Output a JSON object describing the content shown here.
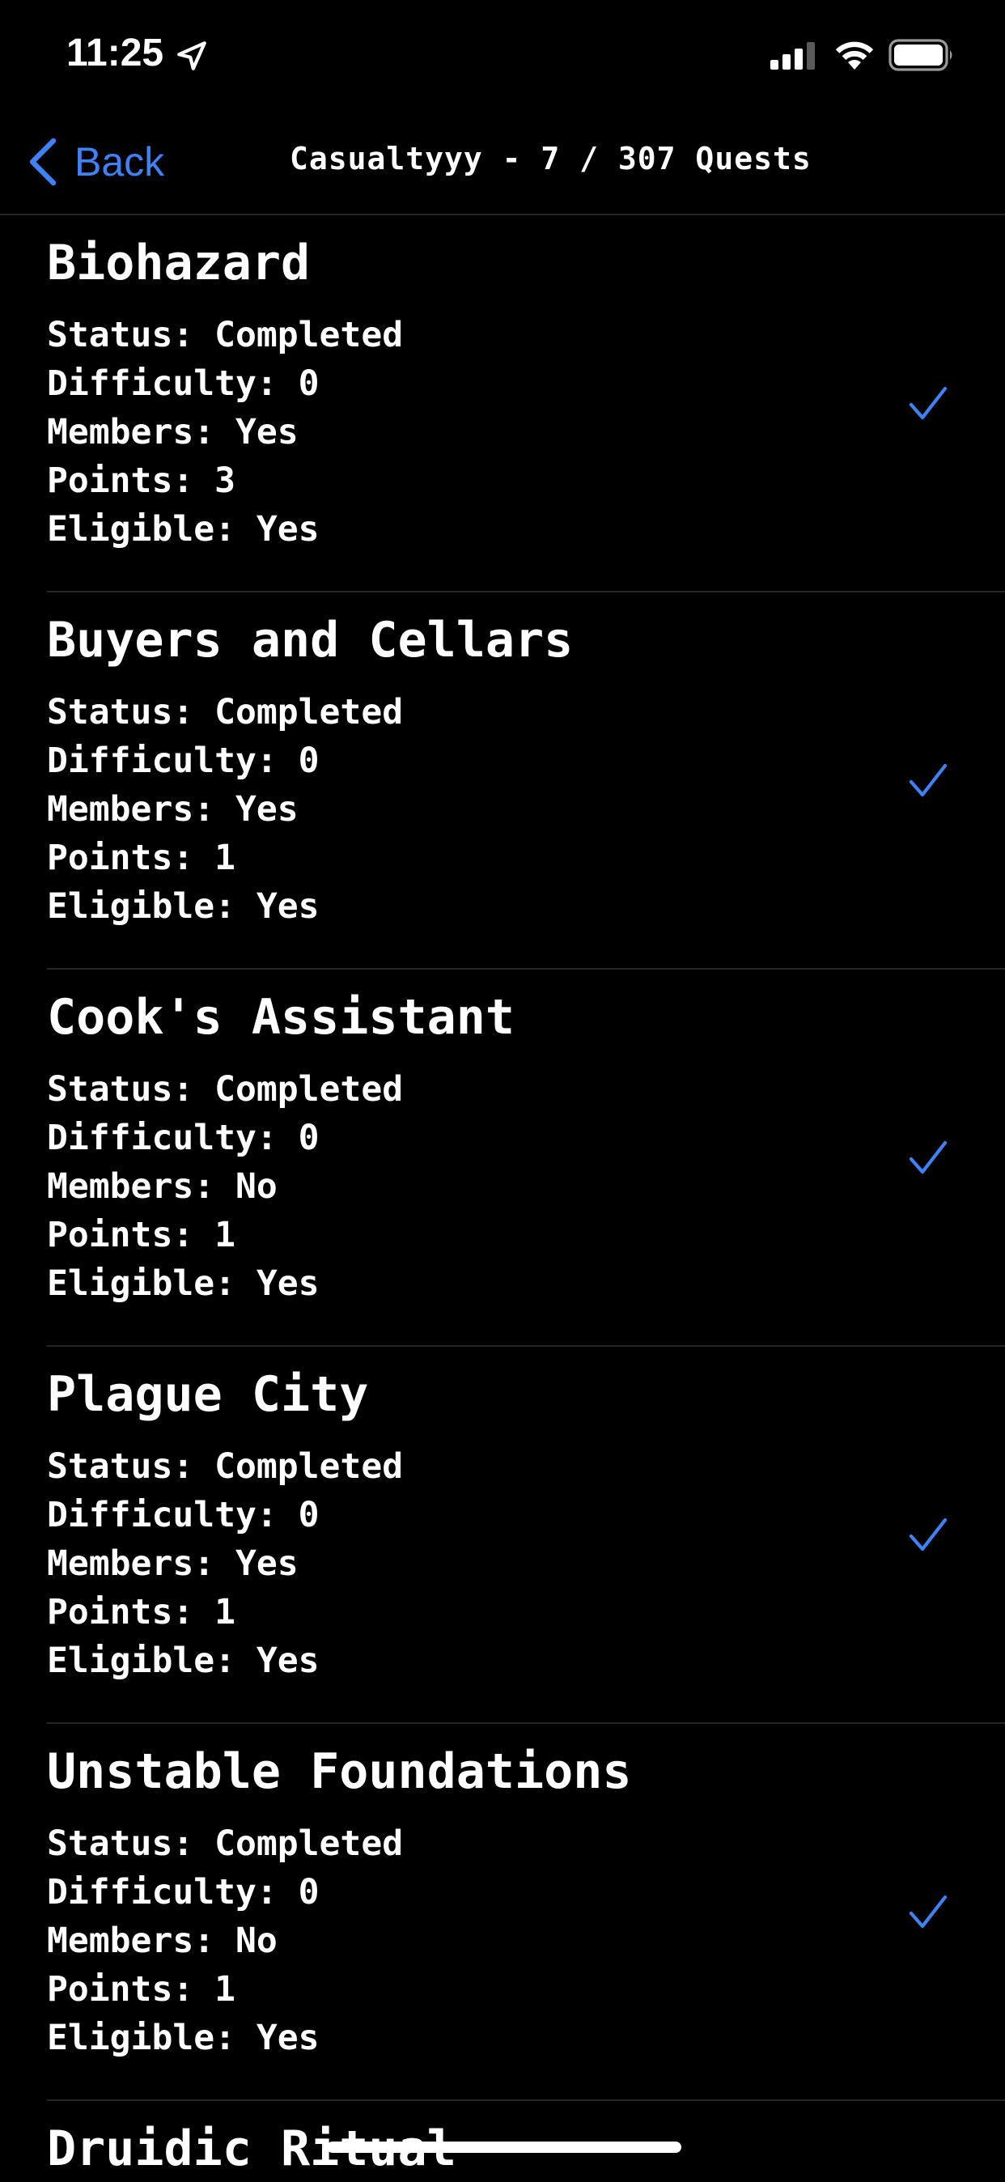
{
  "status_bar": {
    "time": "11:25",
    "location_icon": "location-arrow-icon",
    "signal_icon": "cellular-signal-icon",
    "wifi_icon": "wifi-icon",
    "battery_icon": "battery-icon"
  },
  "nav": {
    "back_label": "Back",
    "title": "Casualtyyy - 7 / 307 Quests"
  },
  "colors": {
    "background": "#000000",
    "accent": "#3d82f6",
    "text": "#ffffff",
    "separator": "#262626"
  },
  "quests": [
    {
      "title": "Biohazard",
      "status": "Status: Completed",
      "difficulty": "Difficulty: 0",
      "members": "Members: Yes",
      "points": "Points: 3",
      "eligible": "Eligible: Yes",
      "checked": true
    },
    {
      "title": "Buyers and Cellars",
      "status": "Status: Completed",
      "difficulty": "Difficulty: 0",
      "members": "Members: Yes",
      "points": "Points: 1",
      "eligible": "Eligible: Yes",
      "checked": true
    },
    {
      "title": "Cook's Assistant",
      "status": "Status: Completed",
      "difficulty": "Difficulty: 0",
      "members": "Members: No",
      "points": "Points: 1",
      "eligible": "Eligible: Yes",
      "checked": true
    },
    {
      "title": "Plague City",
      "status": "Status: Completed",
      "difficulty": "Difficulty: 0",
      "members": "Members: Yes",
      "points": "Points: 1",
      "eligible": "Eligible: Yes",
      "checked": true
    },
    {
      "title": "Unstable Foundations",
      "status": "Status: Completed",
      "difficulty": "Difficulty: 0",
      "members": "Members: No",
      "points": "Points: 1",
      "eligible": "Eligible: Yes",
      "checked": true
    },
    {
      "title": "Druidic Ritual"
    }
  ]
}
